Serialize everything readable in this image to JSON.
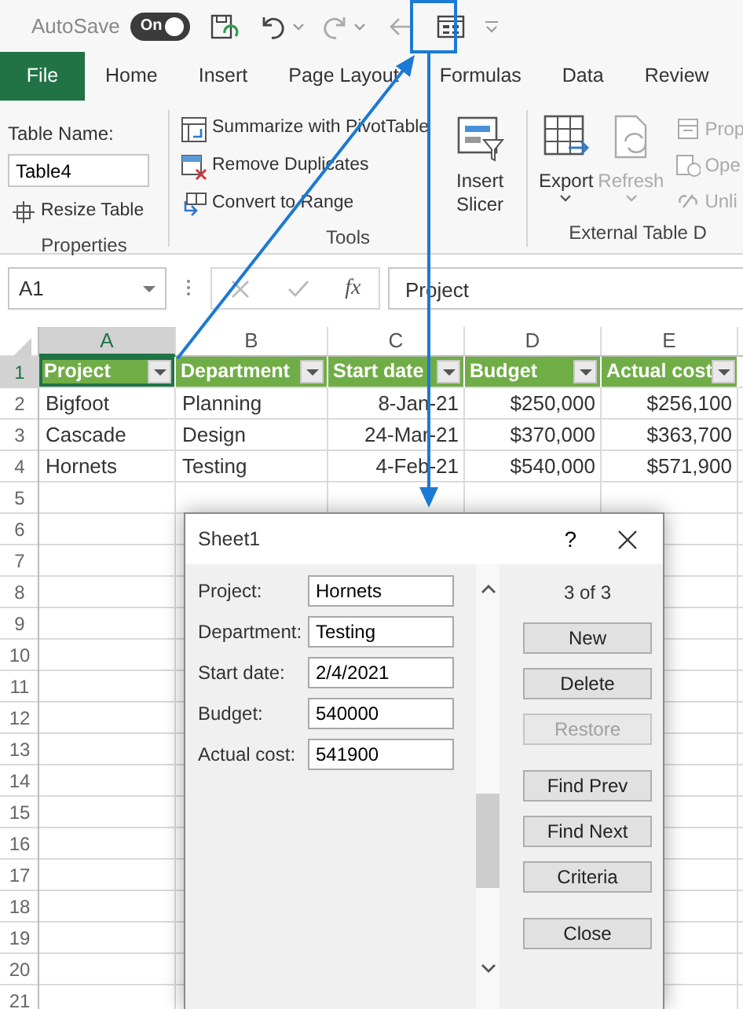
{
  "quick_access": {
    "autosave_label": "AutoSave",
    "autosave_toggle": {
      "label": "On",
      "on": true
    }
  },
  "ribbon": {
    "tabs": [
      {
        "label": "File",
        "kind": "file",
        "selected": false
      },
      {
        "label": "Home",
        "kind": "tab",
        "selected": false
      },
      {
        "label": "Insert",
        "kind": "tab",
        "selected": false
      },
      {
        "label": "Page Layout",
        "kind": "tab",
        "selected": false
      },
      {
        "label": "Formulas",
        "kind": "tab",
        "selected": false
      },
      {
        "label": "Data",
        "kind": "tab",
        "selected": false
      },
      {
        "label": "Review",
        "kind": "tab",
        "selected": false
      }
    ],
    "groups": [
      {
        "kind": "properties",
        "label": "Properties",
        "table_name_label": "Table Name:",
        "table_name": "Table4",
        "buttons": [
          {
            "label": "Resize Table",
            "disabled": false
          }
        ]
      },
      {
        "kind": "tools",
        "label": "Tools",
        "buttons": [
          {
            "label": "Summarize with PivotTable",
            "disabled": false
          },
          {
            "label": "Remove Duplicates",
            "disabled": false
          },
          {
            "label": "Convert to Range",
            "disabled": false
          }
        ],
        "large_buttons": [
          {
            "label": "Insert Slicer",
            "disabled": false
          }
        ]
      },
      {
        "kind": "external",
        "label": "External Table D",
        "large_buttons": [
          {
            "label": "Export",
            "disabled": false
          },
          {
            "label": "Refresh",
            "disabled": true
          }
        ],
        "buttons": [
          {
            "label": "Prop",
            "disabled": true
          },
          {
            "label": "Ope",
            "disabled": true
          },
          {
            "label": "Unli",
            "disabled": true
          }
        ]
      }
    ]
  },
  "formula_bar": {
    "name_box": "A1",
    "function_label": "fx",
    "formula": "Project"
  },
  "sheet": {
    "columns": [
      {
        "letter": "A",
        "kind": "text",
        "selected": true
      },
      {
        "letter": "B",
        "kind": "text",
        "selected": false
      },
      {
        "letter": "C",
        "kind": "number",
        "selected": false
      },
      {
        "letter": "D",
        "kind": "number",
        "selected": false
      },
      {
        "letter": "E",
        "kind": "number",
        "selected": false
      }
    ],
    "header_row": {
      "number": "1",
      "selected": true,
      "cells": [
        {
          "text": "Project",
          "selected": true
        },
        {
          "text": "Department",
          "selected": false
        },
        {
          "text": "Start date",
          "selected": false
        },
        {
          "text": "Budget",
          "selected": false
        },
        {
          "text": "Actual cost",
          "selected": false
        }
      ]
    },
    "rows": [
      {
        "number": "2",
        "selected": false,
        "cells": [
          "Bigfoot",
          "Planning",
          "8-Jan-21",
          "$250,000",
          "$256,100"
        ]
      },
      {
        "number": "3",
        "selected": false,
        "cells": [
          "Cascade",
          "Design",
          "24-Mar-21",
          "$370,000",
          "$363,700"
        ]
      },
      {
        "number": "4",
        "selected": false,
        "cells": [
          "Hornets",
          "Testing",
          "4-Feb-21",
          "$540,000",
          "$571,900"
        ]
      },
      {
        "number": "5",
        "selected": false
      },
      {
        "number": "6",
        "selected": false
      },
      {
        "number": "7",
        "selected": false
      },
      {
        "number": "8",
        "selected": false
      },
      {
        "number": "9",
        "selected": false
      },
      {
        "number": "10",
        "selected": false
      },
      {
        "number": "11",
        "selected": false
      },
      {
        "number": "12",
        "selected": false
      },
      {
        "number": "13",
        "selected": false
      },
      {
        "number": "14",
        "selected": false
      },
      {
        "number": "15",
        "selected": false
      },
      {
        "number": "16",
        "selected": false
      },
      {
        "number": "17",
        "selected": false
      },
      {
        "number": "18",
        "selected": false
      },
      {
        "number": "19",
        "selected": false
      },
      {
        "number": "20",
        "selected": false
      },
      {
        "number": "21",
        "selected": false
      }
    ]
  },
  "dialog": {
    "title": "Sheet1",
    "help": "?",
    "record_counter": "3 of 3",
    "fields": [
      {
        "label": "Project:",
        "value": "Hornets"
      },
      {
        "label": "Department:",
        "value": "Testing"
      },
      {
        "label": "Start date:",
        "value": "2/4/2021"
      },
      {
        "label": "Budget:",
        "value": "540000"
      },
      {
        "label": "Actual cost:",
        "value": "541900"
      }
    ],
    "button_groups": [
      [
        {
          "label": "New",
          "disabled": false
        },
        {
          "label": "Delete",
          "disabled": false
        },
        {
          "label": "Restore",
          "disabled": true
        }
      ],
      [
        {
          "label": "Find Prev",
          "disabled": false
        },
        {
          "label": "Find Next",
          "disabled": false
        },
        {
          "label": "Criteria",
          "disabled": false
        }
      ],
      [
        {
          "label": "Close",
          "disabled": false
        }
      ]
    ]
  }
}
